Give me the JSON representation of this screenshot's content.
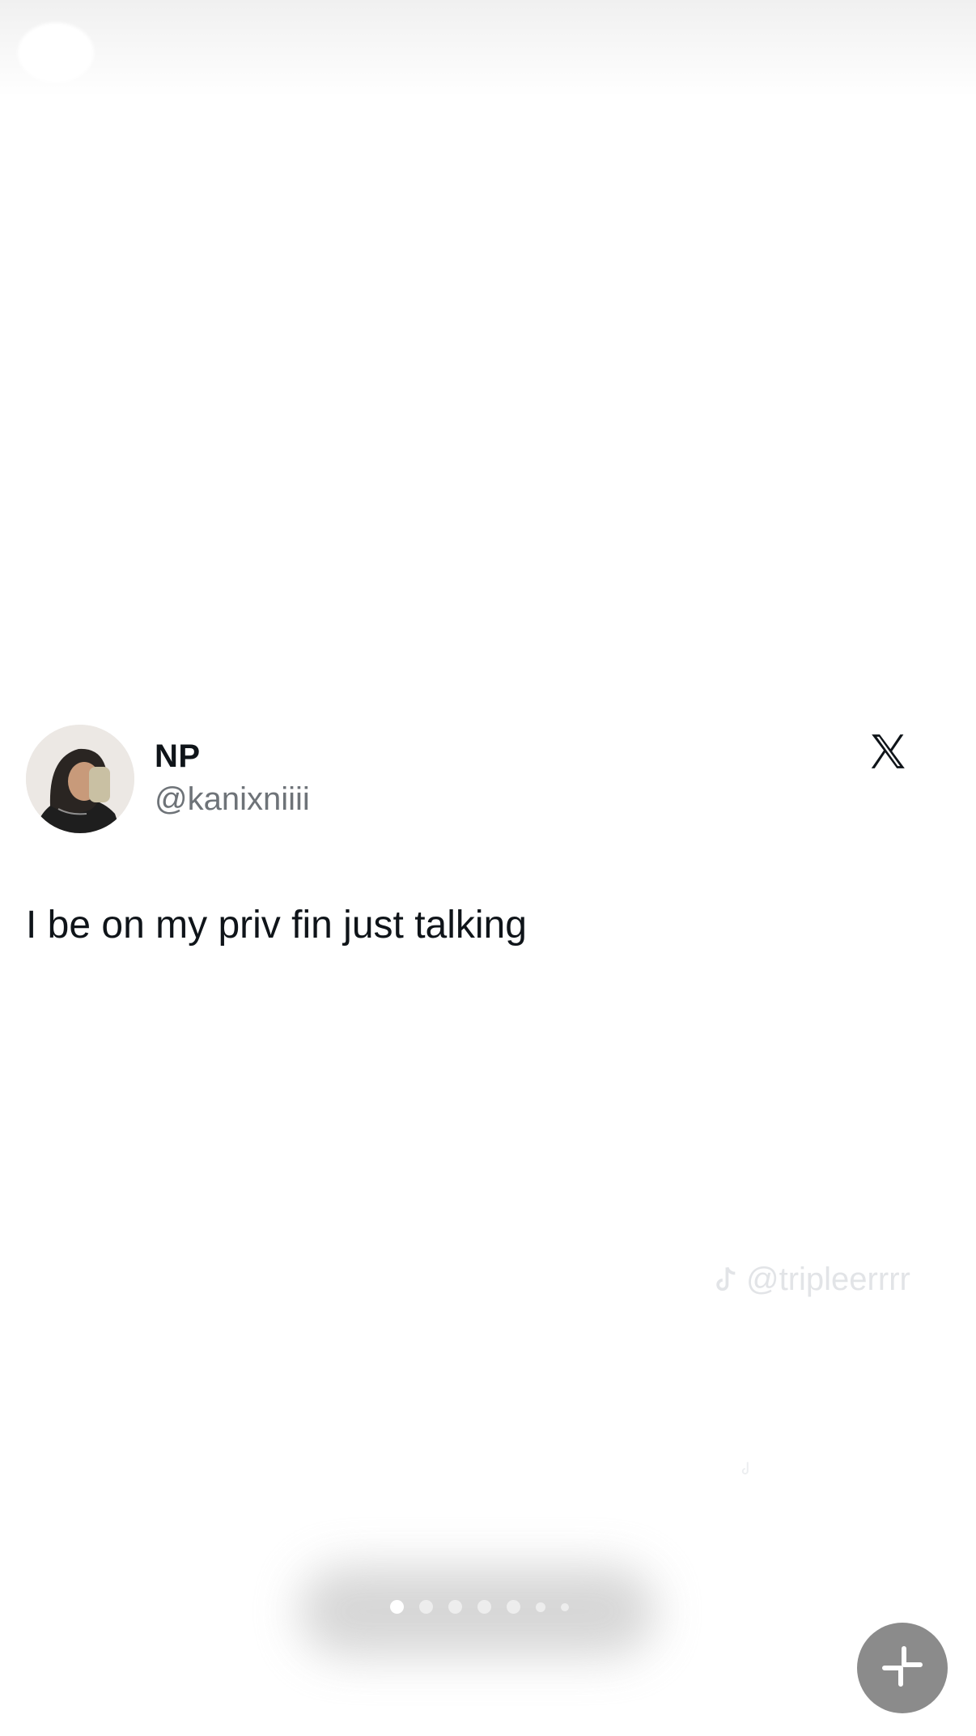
{
  "tweet": {
    "name": "NP",
    "handle": "@kanixniiii",
    "text": "I be on my priv fin just talking"
  },
  "watermark": {
    "text": "@tripleerrrr"
  },
  "pagination": {
    "page_count": 7,
    "current_page": 1
  },
  "icons": {
    "x_logo": "x-logo-icon",
    "tiktok": "tiktok-icon",
    "exit_fullscreen": "exit-fullscreen-icon"
  },
  "colors": {
    "text": "#0f1419",
    "handle": "#6e7378",
    "fab": "#8b8b8b"
  }
}
